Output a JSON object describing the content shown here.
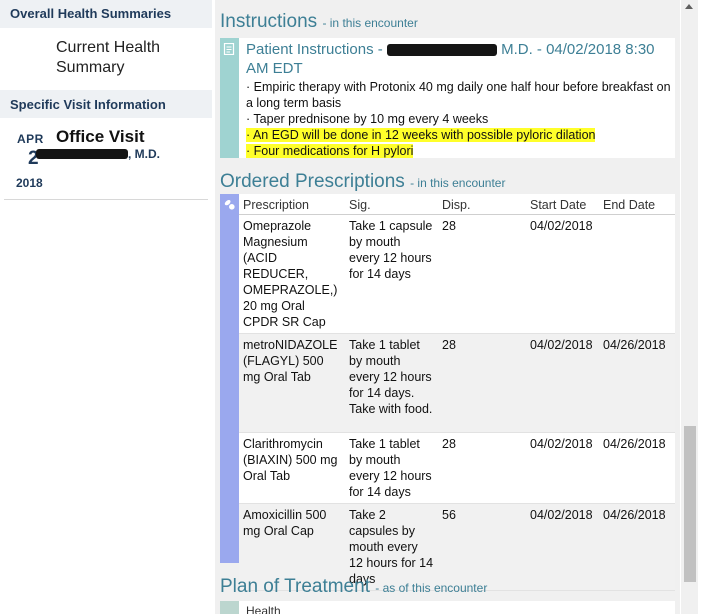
{
  "sidebar": {
    "section1_title": "Overall Health Summaries",
    "current_summary_label": "Current Health Summary",
    "section2_title": "Specific Visit Information",
    "visit": {
      "month": "APR",
      "day": "2",
      "year": "2018",
      "title": "Office Visit",
      "provider_suffix": ", M.D."
    }
  },
  "instructions": {
    "title": "Instructions",
    "subtitle": "- in this encounter",
    "header_prefix": "Patient Instructions -",
    "header_suffix": "M.D. - 04/02/2018 8:30 AM EDT",
    "lines": [
      "· Empiric therapy with Protonix 40 mg daily one half hour before breakfast on a long term basis",
      "· Taper prednisone by 10 mg every 4 weeks",
      "· An EGD will be done in 12 weeks with possible pyloric dilation",
      "· Four medications for H pylori"
    ]
  },
  "prescriptions": {
    "title": "Ordered Prescriptions",
    "subtitle": "- in this encounter",
    "columns": [
      "Prescription",
      "Sig.",
      "Disp.",
      "Start Date",
      "End Date"
    ],
    "rows": [
      {
        "prescription": "Omeprazole Magnesium (ACID REDUCER, OMEPRAZOLE,) 20 mg Oral CPDR SR Cap",
        "sig": "Take 1 capsule by mouth every 12 hours for 14 days",
        "disp": "28",
        "start": "04/02/2018",
        "end": ""
      },
      {
        "prescription": "metroNIDAZOLE (FLAGYL) 500 mg Oral Tab",
        "sig": "Take 1 tablet by mouth every 12 hours for 14 days. Take with food.",
        "disp": "28",
        "start": "04/02/2018",
        "end": "04/26/2018"
      },
      {
        "prescription": "Clarithromycin (BIAXIN) 500 mg Oral Tab",
        "sig": "Take 1 tablet by mouth every 12 hours for 14 days",
        "disp": "28",
        "start": "04/02/2018",
        "end": "04/26/2018"
      },
      {
        "prescription": "Amoxicillin 500 mg Oral Cap",
        "sig": "Take 2 capsules by mouth every 12 hours for 14 days",
        "disp": "56",
        "start": "04/02/2018",
        "end": "04/26/2018"
      }
    ]
  },
  "plan": {
    "title": "Plan of Treatment",
    "subtitle": "- as of this encounter",
    "first_item": "Health"
  },
  "colors": {
    "accent": "#3d7f95",
    "instructions_bar": "#9fd3d1",
    "prescriptions_bar": "#9aa8ee",
    "highlight": "#ffff2a"
  },
  "icons": [
    "document-icon",
    "pills-icon",
    "plan-icon"
  ]
}
